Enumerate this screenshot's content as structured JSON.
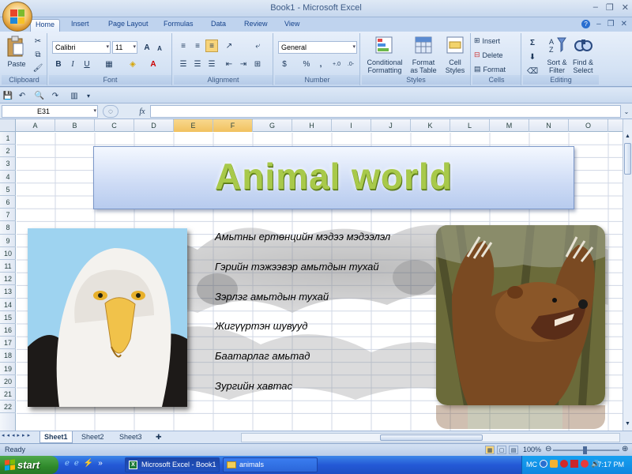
{
  "window": {
    "title": "Book1 - Microsoft Excel",
    "min": "–",
    "restore": "❐",
    "close": "✕"
  },
  "tabs": [
    "Home",
    "Insert",
    "Page Layout",
    "Formulas",
    "Data",
    "Review",
    "View"
  ],
  "ribbon": {
    "clipboard": {
      "label": "Clipboard",
      "paste": "Paste"
    },
    "font": {
      "label": "Font",
      "font_name": "Calibri",
      "font_size": "11",
      "bold": "B",
      "italic": "I",
      "underline": "U",
      "grow": "A",
      "shrink": "A"
    },
    "alignment": {
      "label": "Alignment"
    },
    "number": {
      "label": "Number",
      "format": "General",
      "currency": "$",
      "percent": "%",
      "comma": ",",
      "inc_dec": ".0 .00",
      "dec_dec": ".00 .0"
    },
    "styles": {
      "label": "Styles",
      "conditional": "Conditional Formatting",
      "conditional_1": "Conditional",
      "conditional_2": "Formatting",
      "table_1": "Format",
      "table_2": "as Table",
      "cell_1": "Cell",
      "cell_2": "Styles"
    },
    "cells": {
      "label": "Cells",
      "insert": "Insert",
      "delete": "Delete",
      "format": "Format"
    },
    "editing": {
      "label": "Editing",
      "sum": "Σ",
      "sort_1": "Sort &",
      "sort_2": "Filter",
      "find_1": "Find &",
      "find_2": "Select"
    }
  },
  "formula_bar": {
    "name_box": "E31",
    "fx": "fx",
    "value": ""
  },
  "columns": [
    "A",
    "B",
    "C",
    "D",
    "E",
    "F",
    "G",
    "H",
    "I",
    "J",
    "K",
    "L",
    "M",
    "N",
    "O"
  ],
  "selected_columns": [
    "E",
    "F"
  ],
  "rows": [
    "1",
    "2",
    "3",
    "4",
    "5",
    "6",
    "7",
    "8",
    "9",
    "10",
    "11",
    "12",
    "13",
    "14",
    "15",
    "16",
    "17",
    "18",
    "19",
    "20",
    "21",
    "22"
  ],
  "content": {
    "title": "Animal world",
    "links": [
      "Амьтны ертөнцийн мэдээ мэдээлэл",
      "Гэрийн тэжээвэр амьтдын тухай",
      "Зэрлэг амьтдын тухай",
      "Жигүүртэн шувууд",
      "Баатарлаг амьтад",
      "Зургийн хавтас"
    ]
  },
  "sheets": [
    "Sheet1",
    "Sheet2",
    "Sheet3"
  ],
  "status": {
    "ready": "Ready",
    "zoom": "100%"
  },
  "taskbar": {
    "start": "start",
    "tasks": [
      "Microsoft Excel - Book1",
      "animals"
    ],
    "tray_lang": "MC",
    "clock": "7:17 PM"
  }
}
